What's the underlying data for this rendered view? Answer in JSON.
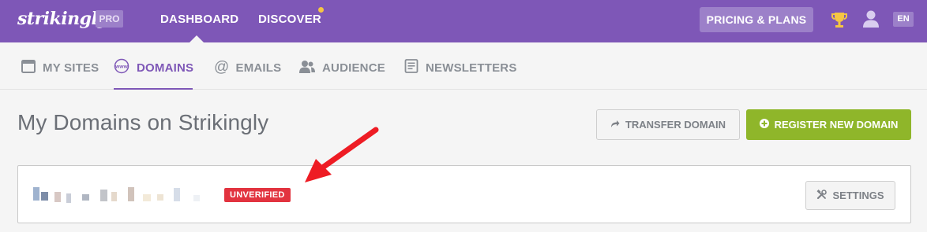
{
  "topbar": {
    "logo": "strikingly",
    "plan_badge": "PRO",
    "nav": [
      {
        "label": "DASHBOARD",
        "active": true
      },
      {
        "label": "DISCOVER",
        "has_notification": true
      }
    ],
    "pricing_label": "PRICING & PLANS",
    "icons": [
      "trophy-icon",
      "user-icon"
    ],
    "language": "EN",
    "colors": {
      "bar": "#7e57b7",
      "badge": "#9c80c9",
      "notification": "#f6c643"
    }
  },
  "subnav": {
    "items": [
      {
        "label": "MY SITES",
        "icon": "browser-window-icon",
        "active": false
      },
      {
        "label": "DOMAINS",
        "icon": "www-globe-icon",
        "active": true
      },
      {
        "label": "EMAILS",
        "icon": "at-sign-icon",
        "active": false
      },
      {
        "label": "AUDIENCE",
        "icon": "people-icon",
        "active": false
      },
      {
        "label": "NEWSLETTERS",
        "icon": "newsletter-icon",
        "active": false
      }
    ]
  },
  "main": {
    "title": "My Domains on Strikingly",
    "transfer_label": "TRANSFER DOMAIN",
    "register_label": "REGISTER NEW DOMAIN",
    "colors": {
      "register": "#8fb62a",
      "accent": "#7e57b7"
    }
  },
  "domain": {
    "status": "UNVERIFIED",
    "status_color": "#e2333f",
    "settings_label": "SETTINGS"
  }
}
